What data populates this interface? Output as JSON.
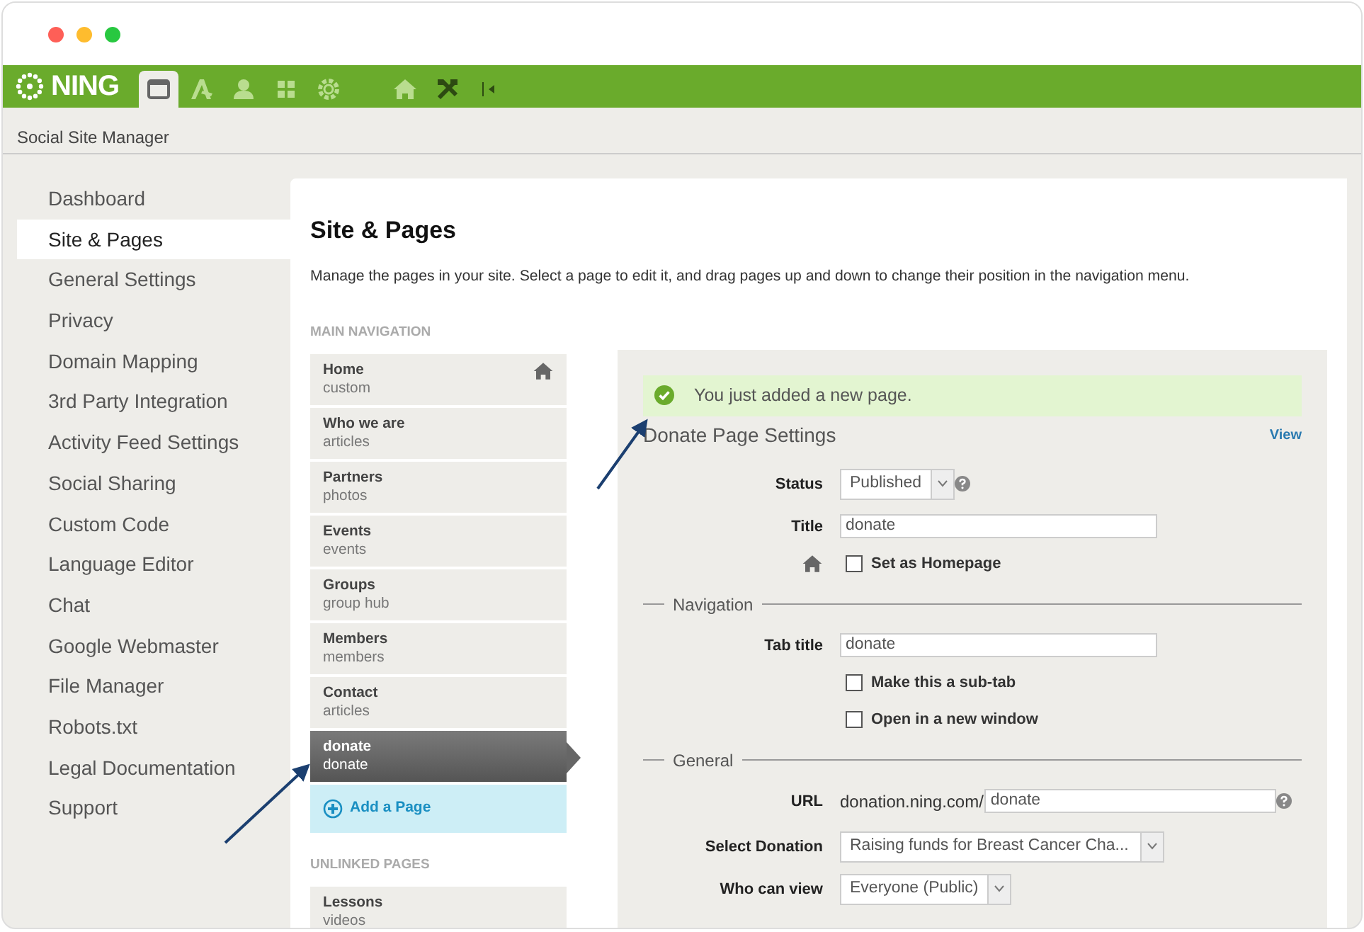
{
  "toolbar": {
    "logo": "NING",
    "icons": [
      {
        "kind": "window",
        "selected": true
      },
      {
        "kind": "pen",
        "selected": false
      },
      {
        "kind": "person",
        "selected": false
      },
      {
        "kind": "grid",
        "selected": false
      },
      {
        "kind": "gear",
        "selected": false
      },
      {
        "kind": "home",
        "selected": false
      },
      {
        "kind": "tools",
        "selected": false
      },
      {
        "kind": "collapse",
        "selected": false
      }
    ]
  },
  "breadcrumb": "Social Site Manager",
  "sidebar": {
    "items": [
      {
        "label": "Dashboard",
        "selected": false
      },
      {
        "label": "Site & Pages",
        "selected": true
      },
      {
        "label": "General Settings",
        "selected": false
      },
      {
        "label": "Privacy",
        "selected": false
      },
      {
        "label": "Domain Mapping",
        "selected": false
      },
      {
        "label": "3rd Party Integration",
        "selected": false
      },
      {
        "label": "Activity Feed Settings",
        "selected": false
      },
      {
        "label": "Social Sharing",
        "selected": false
      },
      {
        "label": "Custom Code",
        "selected": false
      },
      {
        "label": "Language Editor",
        "selected": false
      },
      {
        "label": "Chat",
        "selected": false
      },
      {
        "label": "Google Webmaster",
        "selected": false
      },
      {
        "label": "File Manager",
        "selected": false
      },
      {
        "label": "Robots.txt",
        "selected": false
      },
      {
        "label": "Legal Documentation",
        "selected": false
      },
      {
        "label": "Support",
        "selected": false
      }
    ]
  },
  "main": {
    "title": "Site & Pages",
    "description": "Manage the pages in your site. Select a page to edit it, and drag pages up and down to change their position in the navigation menu.",
    "main_navigation": {
      "heading": "MAIN NAVIGATION",
      "pages": [
        {
          "name": "Home",
          "type": "custom",
          "selected": false,
          "homepage": true
        },
        {
          "name": "Who we are",
          "type": "articles",
          "selected": false,
          "homepage": false
        },
        {
          "name": "Partners",
          "type": "photos",
          "selected": false,
          "homepage": false
        },
        {
          "name": "Events",
          "type": "events",
          "selected": false,
          "homepage": false
        },
        {
          "name": "Groups",
          "type": "group hub",
          "selected": false,
          "homepage": false
        },
        {
          "name": "Members",
          "type": "members",
          "selected": false,
          "homepage": false
        },
        {
          "name": "Contact",
          "type": "articles",
          "selected": false,
          "homepage": false
        },
        {
          "name": "donate",
          "type": "donate",
          "selected": true,
          "homepage": false
        }
      ],
      "add_button": "Add a Page"
    },
    "unlinked_pages": {
      "heading": "UNLINKED PAGES",
      "pages": [
        {
          "name": "Lessons",
          "type": "videos",
          "selected": false,
          "homepage": false
        }
      ]
    },
    "settings": {
      "alert": "You just added a new page.",
      "heading": "Donate Page Settings",
      "view_link": "View",
      "fields": [
        {
          "kind": "select",
          "label": "Status",
          "value": "Published",
          "help": true
        },
        {
          "kind": "text",
          "label": "Title",
          "value": "donate"
        },
        {
          "kind": "checkbox",
          "label": "Set as Homepage",
          "checked": false,
          "home_icon": true
        },
        {
          "kind": "section",
          "label": "Navigation"
        },
        {
          "kind": "text",
          "label": "Tab title",
          "value": "donate"
        },
        {
          "kind": "checkbox",
          "label": "Make this a sub-tab",
          "checked": false
        },
        {
          "kind": "checkbox",
          "label": "Open in a new window",
          "checked": false
        },
        {
          "kind": "section",
          "label": "General"
        },
        {
          "kind": "url",
          "label": "URL",
          "prefix": "donation.ning.com/",
          "value": "donate",
          "help": true
        },
        {
          "kind": "select",
          "label": "Select Donation",
          "value": "Raising funds for Breast Cancer Cha...",
          "wide": true
        },
        {
          "kind": "select",
          "label": "Who can view",
          "value": "Everyone (Public)"
        }
      ]
    }
  }
}
